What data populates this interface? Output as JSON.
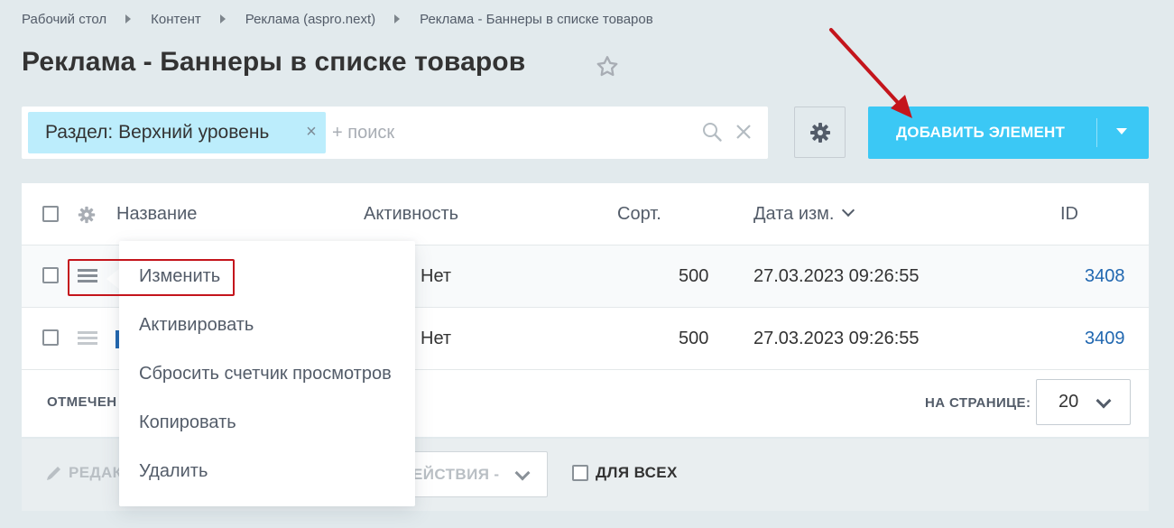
{
  "breadcrumb": [
    "Рабочий стол",
    "Контент",
    "Реклама (aspro.next)",
    "Реклама - Баннеры в списке товаров"
  ],
  "page_title": "Реклама - Баннеры в списке товаров",
  "filter": {
    "tag_label": "Раздел: Верхний уровень",
    "search_placeholder": "+ поиск"
  },
  "add_button_label": "ДОБАВИТЬ ЭЛЕМЕНТ",
  "table": {
    "columns": {
      "name": "Название",
      "active": "Активность",
      "sort": "Сорт.",
      "date": "Дата изм.",
      "id": "ID"
    },
    "rows": [
      {
        "active": "Нет",
        "sort": "500",
        "date": "27.03.2023 09:26:55",
        "id": "3408"
      },
      {
        "active": "Нет",
        "sort": "500",
        "date": "27.03.2023 09:26:55",
        "id": "3409"
      }
    ]
  },
  "footer": {
    "selected_label": "ОТМЕЧЕН",
    "page_size_label": "НА СТРАНИЦЕ:",
    "page_size_value": "20"
  },
  "actions": {
    "edit_label": "РЕДАК",
    "select_label": "ЕЙСТВИЯ -",
    "for_all_label": "ДЛЯ ВСЕХ"
  },
  "context_menu": {
    "items": [
      "Изменить",
      "Активировать",
      "Сбросить счетчик просмотров",
      "Копировать",
      "Удалить"
    ]
  },
  "colors": {
    "accent": "#3bc8f5",
    "filter_tag": "#bcedfc",
    "link": "#2067b0",
    "annotation": "#c4151c"
  },
  "icons": [
    "star-icon",
    "search-icon",
    "clear-icon",
    "gear-icon",
    "chevron-down-icon",
    "menu-icon",
    "pencil-icon",
    "arrow-annotation"
  ]
}
